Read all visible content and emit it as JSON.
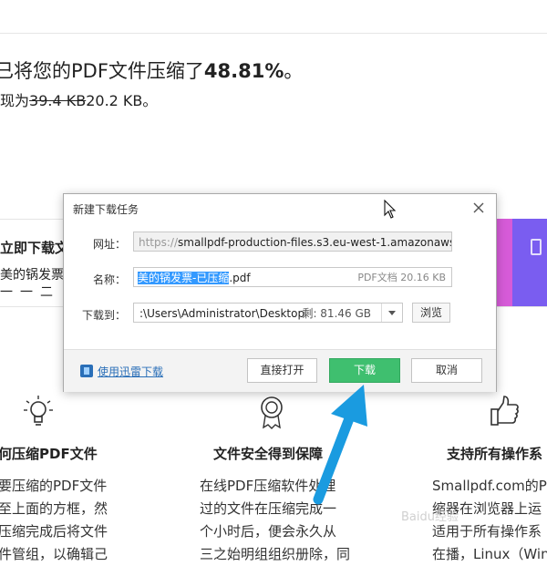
{
  "page": {
    "heading_prefix": "已将您的PDF文件压缩了",
    "heading_percent": "48.81%",
    "heading_suffix": "。",
    "size_prefix": "现为",
    "size_old": "39.4 KB",
    "size_new": "20.2 KB",
    "size_suffix": "。",
    "panel_title": "立即下载文",
    "panel_sub": "美的锅发票",
    "panel_sub2": "一一二",
    "features": [
      {
        "icon": "lightbulb-icon",
        "title": "何压缩PDF文件",
        "lines": [
          "要压缩的PDF文件",
          "至上面的方框，然",
          "压缩完成后将文件",
          "件管组，以确辑己"
        ]
      },
      {
        "icon": "security-badge-icon",
        "title": "文件安全得到保障",
        "lines": [
          "在线PDF压缩软件处理",
          "过的文件在压缩完成一",
          "个小时后，便会永久从",
          "三之始明组组织册除，同"
        ]
      },
      {
        "icon": "thumbs-up-icon",
        "title": "支持所有操作系",
        "lines": [
          "Smallpdf.com的PI",
          "缩器在浏览器上运",
          "适用于所有操作系",
          "在播，Linux（Wine"
        ]
      }
    ],
    "watermark": "Baidu经验"
  },
  "dialog": {
    "title": "新建下载任务",
    "url_label": "网址：",
    "url_protocol": "https://",
    "url_rest": "smallpdf-production-files.s3.eu-west-1.amazonaws.",
    "name_label": "名称：",
    "name_selected": "美的锅发票-已压缩",
    "name_ext": ".pdf",
    "name_meta": "PDF文档 20.16 KB",
    "path_label": "下载到：",
    "path_value": ":\\Users\\Administrator\\Desktop",
    "path_space": "剩: 81.46 GB",
    "browse_label": "浏览",
    "thunder_link": "使用迅雷下载",
    "open_label": "直接打开",
    "download_label": "下载",
    "cancel_label": "取消"
  },
  "colors": {
    "download_button": "#3fbf6f",
    "arrow": "#1a9be0",
    "selection": "#3399ff",
    "accent_pink": "#d65bd8",
    "accent_purple": "#7a5df0"
  }
}
